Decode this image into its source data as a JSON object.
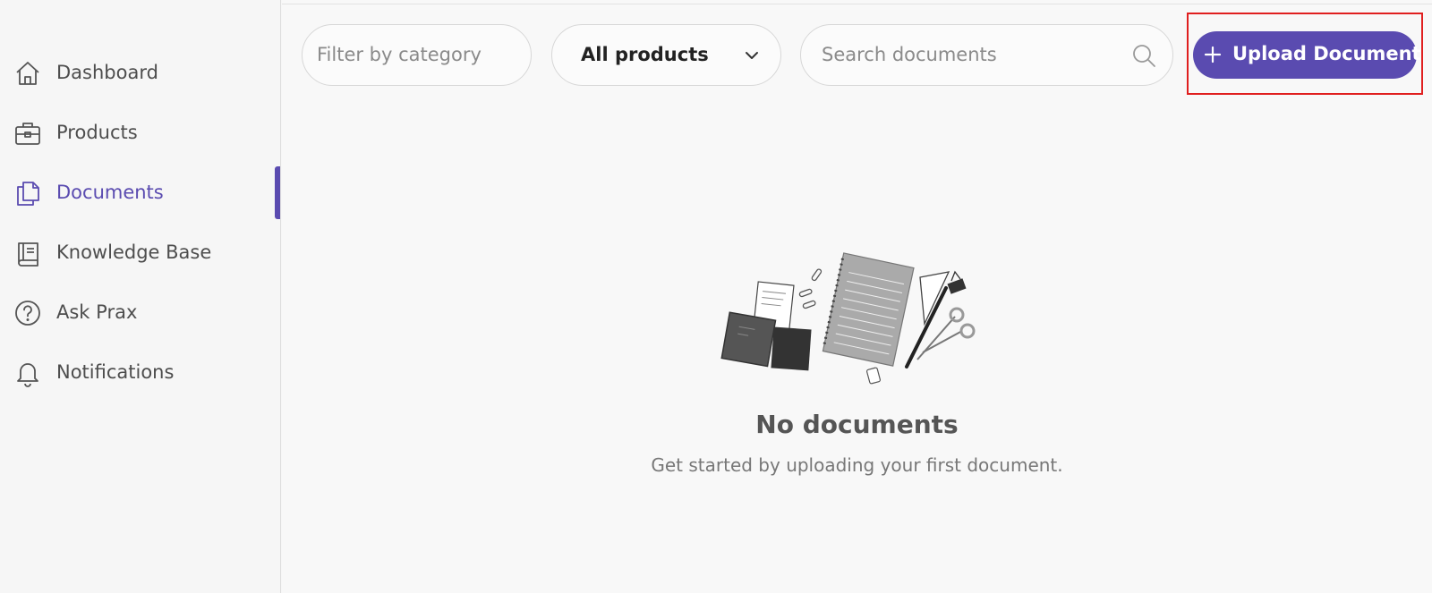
{
  "sidebar": {
    "items": [
      {
        "label": "Dashboard",
        "icon": "home-icon"
      },
      {
        "label": "Products",
        "icon": "briefcase-icon"
      },
      {
        "label": "Documents",
        "icon": "documents-icon",
        "active": true
      },
      {
        "label": "Knowledge Base",
        "icon": "book-icon"
      },
      {
        "label": "Ask Prax",
        "icon": "question-circle-icon"
      },
      {
        "label": "Notifications",
        "icon": "bell-icon"
      }
    ]
  },
  "toolbar": {
    "category_filter_placeholder": "Filter by category",
    "product_select_value": "All products",
    "search_placeholder": "Search documents",
    "upload_label": "Upload Document"
  },
  "empty_state": {
    "title": "No documents",
    "subtitle": "Get started by uploading your first document."
  },
  "colors": {
    "accent": "#5a4bb0",
    "highlight": "#e01f1f"
  }
}
